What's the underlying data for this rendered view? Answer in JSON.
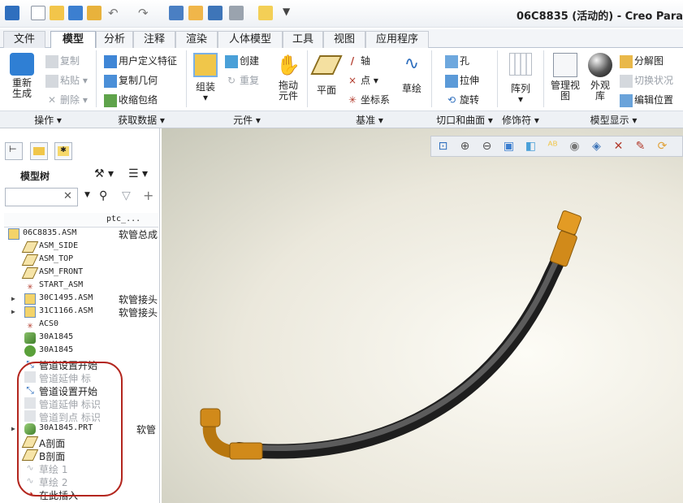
{
  "window": {
    "title": "06C8835 (活动的) - Creo Para"
  },
  "quick_access": [
    "app-icon",
    "new-icon",
    "open-icon",
    "save-icon",
    "regenerate-icon",
    "undo-icon",
    "redo-icon",
    "model-intent-icon",
    "edit-icon",
    "window-icon",
    "close-window-icon",
    "folder-icon",
    "customize-icon"
  ],
  "tabs": [
    "文件",
    "模型",
    "分析",
    "注释",
    "渲染",
    "人体模型",
    "工具",
    "视图",
    "应用程序"
  ],
  "active_tab": "模型",
  "ribbon": {
    "operations": {
      "regenerate": "重新生成",
      "copy": "复制",
      "paste": "粘贴",
      "delete": "删除",
      "group_label": "操作"
    },
    "get_data": {
      "udf": "用户定义特征",
      "copy_geom": "复制几何",
      "shrinkwrap": "收缩包络",
      "group_label": "获取数据"
    },
    "component": {
      "assemble": "组装",
      "create": "创建",
      "repeat": "重复",
      "drag": "拖动元件",
      "group_label": "元件"
    },
    "datum": {
      "plane": "平面",
      "axis": "轴",
      "point": "点",
      "csys": "坐标系",
      "sketch": "草绘",
      "group_label": "基准"
    },
    "cut_surface": {
      "hole": "孔",
      "extrude": "拉伸",
      "revolve": "旋转",
      "group_label": "切口和曲面"
    },
    "modifiers": {
      "pattern": "阵列",
      "group_label": "修饰符"
    },
    "model_display": {
      "manage_views": "管理视图",
      "appearance": "外观库",
      "explode": "分解图",
      "toggle_state": "切换状况",
      "edit_position": "编辑位置",
      "group_label": "模型显示"
    }
  },
  "left_panel": {
    "title": "模型树",
    "search_placeholder": "",
    "column_header": "ptc_...",
    "rows": [
      {
        "label": "06C8835.ASM",
        "col2": "软管总成",
        "indent": 0,
        "icon": "assembly-icon",
        "expander": false,
        "dim": false
      },
      {
        "label": "ASM_SIDE",
        "col2": "",
        "indent": 1,
        "icon": "datum-plane-icon",
        "expander": false,
        "dim": false
      },
      {
        "label": "ASM_TOP",
        "col2": "",
        "indent": 1,
        "icon": "datum-plane-icon",
        "expander": false,
        "dim": false
      },
      {
        "label": "ASM_FRONT",
        "col2": "",
        "indent": 1,
        "icon": "datum-plane-icon",
        "expander": false,
        "dim": false
      },
      {
        "label": "START_ASM",
        "col2": "",
        "indent": 1,
        "icon": "csys-icon",
        "expander": false,
        "dim": false
      },
      {
        "label": "30C1495.ASM",
        "col2": "软管接头",
        "indent": 1,
        "icon": "assembly-icon",
        "expander": true,
        "dim": false
      },
      {
        "label": "31C1166.ASM",
        "col2": "软管接头",
        "indent": 1,
        "icon": "assembly-icon",
        "expander": true,
        "dim": false
      },
      {
        "label": "ACS0",
        "col2": "",
        "indent": 1,
        "icon": "csys-icon",
        "expander": false,
        "dim": false
      },
      {
        "label": "30A1845",
        "col2": "",
        "indent": 1,
        "icon": "pipe-part-icon",
        "expander": false,
        "dim": false
      },
      {
        "label": "30A1845",
        "col2": "",
        "indent": 1,
        "icon": "pipe-route-icon",
        "expander": false,
        "dim": false
      },
      {
        "label": "管道设置开始",
        "col2": "",
        "indent": 1,
        "icon": "route-start-icon",
        "expander": false,
        "dim": false
      },
      {
        "label": "管道延伸 标",
        "col2": "",
        "indent": 1,
        "icon": "route-extend-icon",
        "expander": false,
        "dim": true
      },
      {
        "label": "管道设置开始",
        "col2": "",
        "indent": 1,
        "icon": "route-start-icon",
        "expander": false,
        "dim": false
      },
      {
        "label": "管道延伸 标识",
        "col2": "",
        "indent": 1,
        "icon": "route-extend-icon",
        "expander": false,
        "dim": true
      },
      {
        "label": "管道到点 标识",
        "col2": "",
        "indent": 1,
        "icon": "route-extend-icon",
        "expander": false,
        "dim": true
      },
      {
        "label": "30A1845.PRT",
        "col2": "软管",
        "indent": 1,
        "icon": "hose-part-icon",
        "expander": true,
        "dim": false
      },
      {
        "label": "A剖面",
        "col2": "",
        "indent": 1,
        "icon": "section-icon",
        "expander": false,
        "dim": false
      },
      {
        "label": "B剖面",
        "col2": "",
        "indent": 1,
        "icon": "section-icon",
        "expander": false,
        "dim": false
      },
      {
        "label": "草绘 1",
        "col2": "",
        "indent": 1,
        "icon": "sketch-icon",
        "expander": false,
        "dim": true
      },
      {
        "label": "草绘 2",
        "col2": "",
        "indent": 1,
        "icon": "sketch-icon",
        "expander": false,
        "dim": true
      },
      {
        "label": "在此插入",
        "col2": "",
        "indent": 1,
        "icon": "insert-here-icon",
        "expander": false,
        "dim": false
      }
    ]
  },
  "colors": {
    "hose": "#3a3a3a",
    "fitting": "#d18a1a",
    "highlight_circle": "#b3261e",
    "view_bg": "#ebe8dc"
  },
  "view_toolbar": [
    "refit-icon",
    "zoom-in-icon",
    "zoom-out-icon",
    "repaint-icon",
    "display-style-icon",
    "saved-orientations-icon",
    "view-manager-icon",
    "perspective-icon",
    "datum-display-icon",
    "annotation-display-icon",
    "spin-center-icon"
  ]
}
